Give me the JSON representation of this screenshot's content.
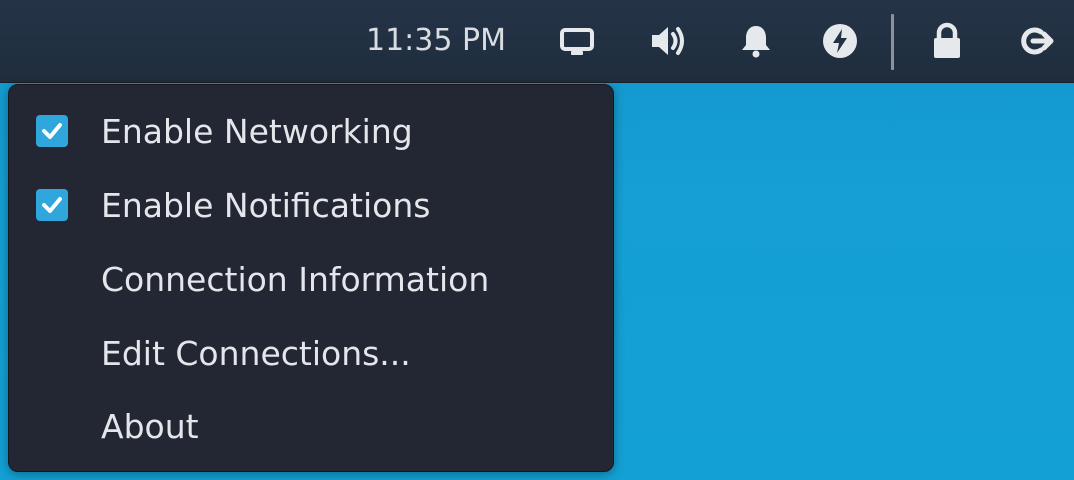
{
  "panel": {
    "clock": "11:35 PM",
    "tray_icons": [
      {
        "name": "display-icon"
      },
      {
        "name": "volume-icon"
      },
      {
        "name": "bell-icon"
      },
      {
        "name": "power-icon"
      },
      {
        "name": "lock-icon"
      },
      {
        "name": "logout-icon"
      }
    ]
  },
  "menu": {
    "items": [
      {
        "label": "Enable Networking",
        "checked": true
      },
      {
        "label": "Enable Notifications",
        "checked": true
      },
      {
        "label": "Connection Information",
        "checked": null
      },
      {
        "label": "Edit Connections...",
        "checked": null
      },
      {
        "label": "About",
        "checked": null
      }
    ]
  },
  "colors": {
    "desktop": "#1a9ed0",
    "panel": "#223244",
    "menu_bg": "#232733",
    "checkbox": "#2fa6dc",
    "text": "#e3e6ea"
  }
}
